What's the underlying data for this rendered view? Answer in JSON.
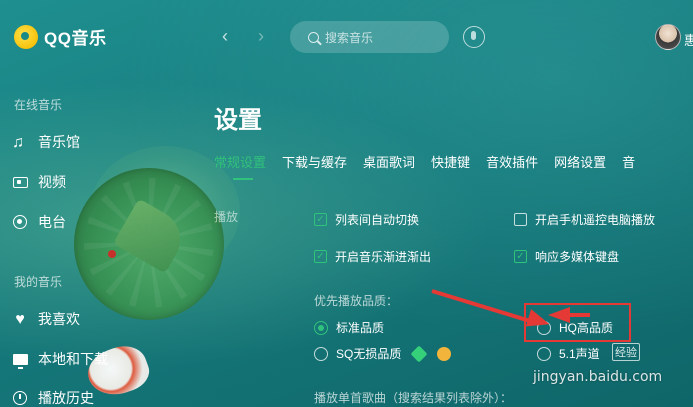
{
  "app": {
    "name": "QQ音乐"
  },
  "header": {
    "back_glyph": "‹",
    "forward_glyph": "›",
    "search_placeholder": "搜索音乐",
    "username_fragment": "惠"
  },
  "sidebar": {
    "online_title": "在线音乐",
    "online_items": [
      {
        "label": "音乐馆",
        "icon": "music-note-icon"
      },
      {
        "label": "视频",
        "icon": "video-icon"
      },
      {
        "label": "电台",
        "icon": "radio-icon"
      }
    ],
    "mine_title": "我的音乐",
    "mine_items": [
      {
        "label": "我喜欢",
        "icon": "heart-icon"
      },
      {
        "label": "本地和下载",
        "icon": "monitor-icon"
      },
      {
        "label": "播放历史",
        "icon": "history-icon"
      }
    ]
  },
  "main": {
    "title": "设置",
    "tabs": [
      {
        "label": "常规设置",
        "active": true
      },
      {
        "label": "下载与缓存",
        "active": false
      },
      {
        "label": "桌面歌词",
        "active": false
      },
      {
        "label": "快捷键",
        "active": false
      },
      {
        "label": "音效插件",
        "active": false
      },
      {
        "label": "网络设置",
        "active": false
      },
      {
        "label": "音",
        "active": false
      }
    ],
    "section_label": "播放",
    "checkboxes": [
      {
        "label": "列表间自动切换",
        "checked": true
      },
      {
        "label": "开启手机遥控电脑播放",
        "checked": false
      },
      {
        "label": "开启音乐渐进渐出",
        "checked": true
      },
      {
        "label": "响应多媒体键盘",
        "checked": true
      }
    ],
    "quality_title": "优先播放品质：",
    "quality_options": [
      {
        "label": "标准品质",
        "selected": true
      },
      {
        "label": "HQ高品质",
        "selected": false
      },
      {
        "label": "SQ无损品质",
        "selected": false
      },
      {
        "label": "5.1声道",
        "selected": false
      }
    ],
    "single_play_title": "播放单首歌曲（搜索结果列表除外）："
  },
  "watermark": {
    "text": "jingyan.baidu.com",
    "tag": "经验"
  },
  "colors": {
    "accent_green": "#31c27c",
    "annotation_red": "#e53935",
    "background_teal": "#167a7c"
  }
}
